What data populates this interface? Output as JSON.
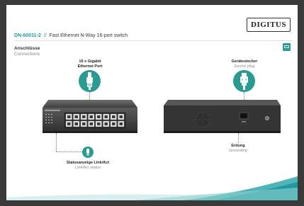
{
  "brand": {
    "logo_text": "DIGITUS"
  },
  "header": {
    "model": "DN-60011-2",
    "separator": "//",
    "description": "Fast Ethernet N-Way 16-port switch"
  },
  "section": {
    "title_de": "Anschlüsse",
    "title_en": "Connections"
  },
  "callouts": {
    "ethernet": {
      "line1": "16 x Gigabit",
      "line2": "Ethernet Port"
    },
    "device_plug": {
      "de": "Gerätestecker",
      "en": "Device plug"
    },
    "status": {
      "de": "Statusanzeige Link/Act",
      "en": "Link/Act status"
    },
    "grounding": {
      "de": "Erdung",
      "en": "Grounding"
    }
  },
  "icons": {
    "ethernet": "ethernet-plug-icon",
    "device_plug": "power-plug-icon",
    "status": "led-indicator-icon",
    "badge": "switch-badge-icon"
  },
  "colors": {
    "accent": "#2a9a92",
    "title_accent": "#1e9aa0",
    "frame": "#3a3a3a"
  },
  "product": {
    "port_count": 16
  }
}
